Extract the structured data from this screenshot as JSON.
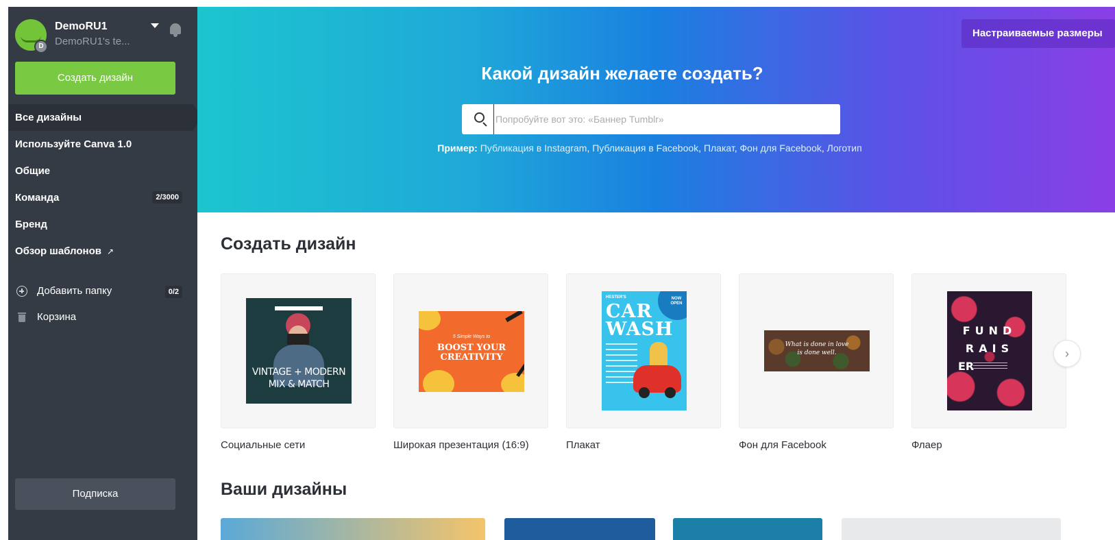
{
  "profile": {
    "username": "DemoRU1",
    "team": "DemoRU1's te...",
    "avatar_initial": "D"
  },
  "sidebar": {
    "create_button": "Создать дизайн",
    "nav": [
      {
        "label": "Все дизайны",
        "active": true
      },
      {
        "label": "Используйте Canva 1.0"
      },
      {
        "label": "Общие"
      },
      {
        "label": "Команда",
        "count": "2/3000"
      },
      {
        "label": "Бренд"
      },
      {
        "label": "Обзор шаблонов",
        "external_icon": "↗"
      }
    ],
    "add_folder": {
      "label": "Добавить папку",
      "count": "0/2"
    },
    "trash": {
      "label": "Корзина"
    },
    "subscribe_button": "Подписка"
  },
  "hero": {
    "custom_sizes_button": "Настраиваемые размеры",
    "title": "Какой дизайн желаете создать?",
    "search_placeholder": "Попробуйте вот это: «Баннер Tumblr»",
    "examples_label": "Пример:",
    "examples": [
      "Публикация в Instagram",
      "Публикация в Facebook",
      "Плакат",
      "Фон для Facebook",
      "Логотип"
    ]
  },
  "create_section": {
    "title": "Создать дизайн",
    "cards": [
      {
        "label": "Социальные сети",
        "thumb_lines": [
          "VINTAGE + MODERN",
          "MIX & MATCH"
        ]
      },
      {
        "label": "Широкая презентация (16:9)",
        "thumb_lines": [
          "5 Simple Ways to",
          "BOOST YOUR",
          "CREATIVITY"
        ]
      },
      {
        "label": "Плакат",
        "thumb_lines": [
          "HESTER'S",
          "CAR",
          "WASH",
          "NOW OPEN"
        ]
      },
      {
        "label": "Фон для Facebook",
        "thumb_lines": [
          "What is done in love",
          "is done well."
        ]
      },
      {
        "label": "Флаер",
        "thumb_lines": [
          "FUND",
          "RAIS",
          "ER"
        ]
      }
    ],
    "next_arrow": "›"
  },
  "your_designs": {
    "title": "Ваши дизайны"
  },
  "colors": {
    "sidebar_bg": "#353b45",
    "accent_green": "#7ac943",
    "hero_gradient_start": "#1cc5cf",
    "hero_gradient_end": "#8a3fe6"
  },
  "icons": [
    "bell-icon",
    "caret-down-icon",
    "search-icon",
    "plus-circle-icon",
    "trash-icon",
    "external-link-icon",
    "chevron-right-icon"
  ]
}
